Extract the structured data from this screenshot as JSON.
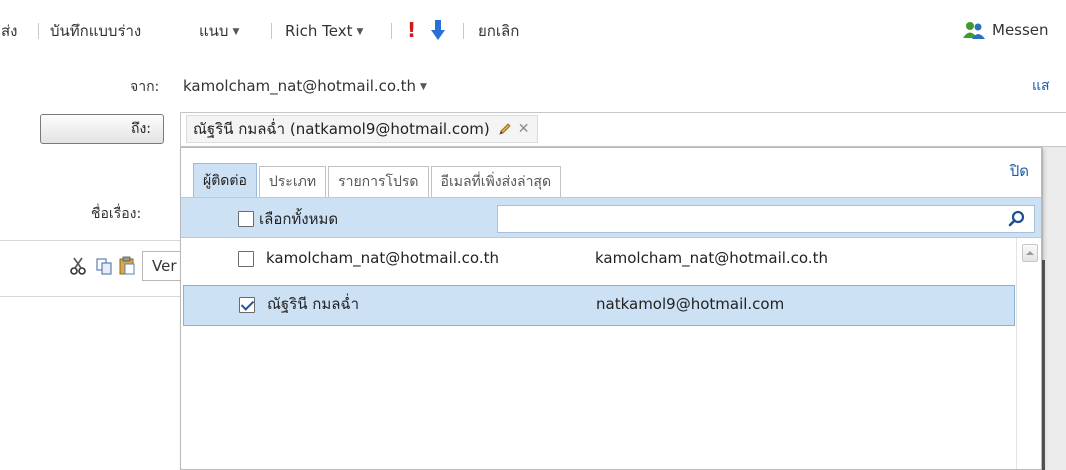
{
  "toolbar": {
    "send": "ส่ง",
    "save_draft": "บันทึกแบบร่าง",
    "attach": "แนบ",
    "rich_text": "Rich Text",
    "cancel": "ยกเลิก",
    "messenger": "Messen",
    "icons": [
      "high-priority-icon",
      "low-priority-icon",
      "messenger-icon"
    ],
    "colors": {
      "high_priority": "#d11a1a",
      "low_priority": "#2a6fd6"
    }
  },
  "header": {
    "from_label": "จาก:",
    "from_value": "kamolcham_nat@hotmail.co.th",
    "show_link": "แส",
    "to_button": "ถึง:",
    "recipient": "ณัฐรินี กมลฉ่ำ (natkamol9@hotmail.com)",
    "subject_label": "ชื่อเรื่อง:"
  },
  "format_bar": {
    "font_select": "Ver",
    "icons": [
      "cut-icon",
      "copy-icon",
      "paste-icon"
    ]
  },
  "picker": {
    "close": "ปิด",
    "tabs": [
      {
        "label": "ผู้ติดต่อ",
        "active": true
      },
      {
        "label": "ประเภท",
        "active": false
      },
      {
        "label": "รายการโปรด",
        "active": false
      },
      {
        "label": "อีเมลที่เพิ่งส่งล่าสุด",
        "active": false
      }
    ],
    "select_all": "เลือกทั้งหมด",
    "search_placeholder": "",
    "contacts": [
      {
        "name": "kamolcham_nat@hotmail.co.th",
        "email": "kamolcham_nat@hotmail.co.th",
        "checked": false
      },
      {
        "name": "ณัฐรินี กมลฉ่ำ",
        "email": "natkamol9@hotmail.com",
        "checked": true
      }
    ],
    "colors": {
      "selection": "#cde1f5",
      "link": "#1c5fa8"
    }
  }
}
